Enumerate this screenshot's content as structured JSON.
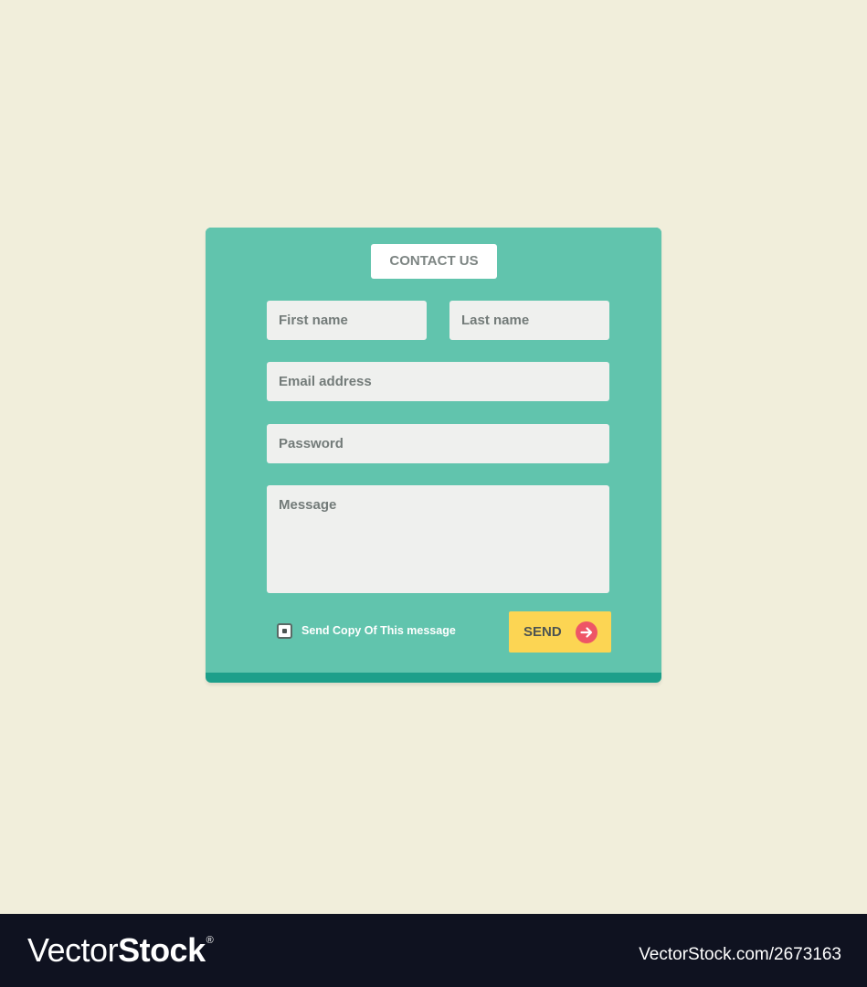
{
  "form": {
    "title": "CONTACT US",
    "fields": {
      "first_name": {
        "placeholder": "First name"
      },
      "last_name": {
        "placeholder": "Last name"
      },
      "email": {
        "placeholder": "Email address"
      },
      "password": {
        "placeholder": "Password"
      },
      "message": {
        "placeholder": "Message"
      }
    },
    "send_copy": {
      "label": "Send Copy Of This message",
      "checked": true
    },
    "send_button": {
      "label": "SEND",
      "icon": "arrow-right-circle-icon"
    }
  },
  "footer": {
    "brand_light": "Vector",
    "brand_bold": "Stock",
    "brand_mark": "®",
    "url": "VectorStock.com/2673163"
  },
  "colors": {
    "background": "#f1eedb",
    "card": "#61c4ad",
    "card_edge": "#1d9f8a",
    "field": "#eff0ee",
    "button": "#fcd553",
    "button_icon": "#ee5566",
    "footer": "#0f1220"
  }
}
